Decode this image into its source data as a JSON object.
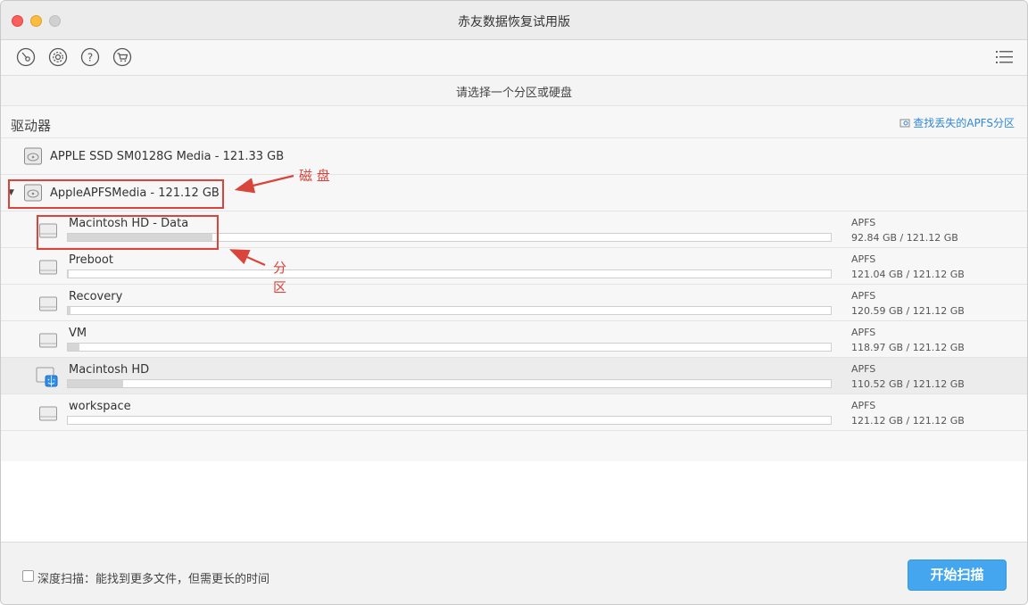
{
  "window": {
    "title": "赤友数据恢复试用版"
  },
  "toolbar": {
    "icons": [
      "disk-recovery-icon",
      "settings-icon",
      "help-icon",
      "cart-icon",
      "list-menu-icon"
    ]
  },
  "subtitle": "请选择一个分区或硬盘",
  "section": {
    "title": "驱动器",
    "apfs_link": "查找丢失的APFS分区"
  },
  "disks": [
    {
      "label": "APPLE SSD SM0128G Media - 121.33 GB"
    },
    {
      "label": "AppleAPFSMedia - 121.12 GB"
    }
  ],
  "partitions": [
    {
      "name": "Macintosh HD - Data",
      "fs": "APFS",
      "size": "92.84 GB / 121.12 GB",
      "used": 0.19
    },
    {
      "name": "Preboot",
      "fs": "APFS",
      "size": "121.04 GB / 121.12 GB",
      "used": 0.001
    },
    {
      "name": "Recovery",
      "fs": "APFS",
      "size": "120.59 GB / 121.12 GB",
      "used": 0.004
    },
    {
      "name": "VM",
      "fs": "APFS",
      "size": "118.97 GB / 121.12 GB",
      "used": 0.015
    },
    {
      "name": "Macintosh HD",
      "fs": "APFS",
      "size": "110.52 GB / 121.12 GB",
      "used": 0.072
    },
    {
      "name": "workspace",
      "fs": "APFS",
      "size": "121.12 GB / 121.12 GB",
      "used": 0.0
    }
  ],
  "annotations": {
    "disk_note": "磁 盘",
    "partition_note_1": "分",
    "partition_note_2": "区"
  },
  "footer": {
    "deep_scan_label": "深度扫描：能找到更多文件，但需更长的时间",
    "scan_button": "开始扫描"
  },
  "colors": {
    "accent": "#43a6ee",
    "link": "#2f88d8",
    "annotation": "#d9443b"
  }
}
